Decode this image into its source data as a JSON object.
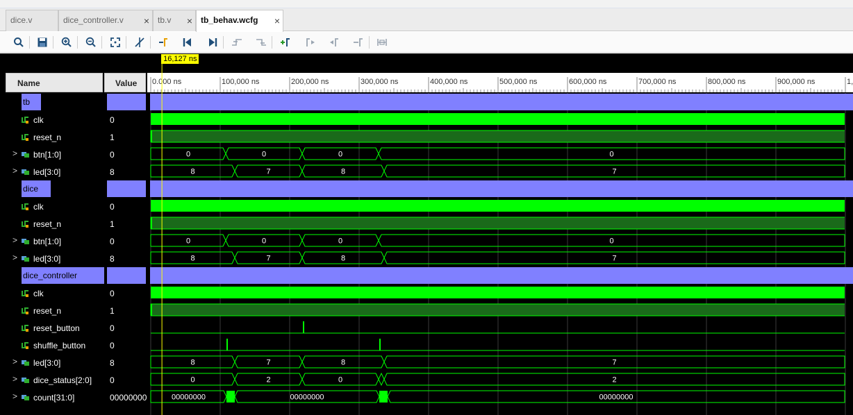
{
  "tabs": [
    {
      "label": "dice.v",
      "close": "×",
      "active": false
    },
    {
      "label": "dice_controller.v",
      "close": "×",
      "active": false
    },
    {
      "label": "tb.v",
      "close": "×",
      "active": false
    },
    {
      "label": "tb_behav.wcfg",
      "close": "×",
      "active": true
    }
  ],
  "toolbar": {
    "icons": [
      "search-icon",
      "save-icon",
      "zoom-in-icon",
      "zoom-out-icon",
      "zoom-fit-icon",
      "cursor-off-icon",
      "goto-cursor-icon",
      "goto-start-icon",
      "goto-end-icon",
      "prev-transition-icon",
      "next-transition-icon",
      "add-marker-icon",
      "prev-marker-icon",
      "next-marker-icon",
      "swap-cursors-icon",
      "fit-markers-icon"
    ]
  },
  "columns": {
    "name": "Name",
    "value": "Value"
  },
  "cursor": {
    "label": "16,127 ns",
    "time_ns": 16127
  },
  "timeline": {
    "ticks": [
      "0.000 ns",
      "100,000 ns",
      "200,000 ns",
      "300,000 ns",
      "400,000 ns",
      "500,000 ns",
      "600,000 ns",
      "700,000 ns",
      "800,000 ns",
      "900,000 ns",
      "1,"
    ],
    "tick_values_ns": [
      0,
      100000,
      200000,
      300000,
      400000,
      500000,
      600000,
      700000,
      800000,
      900000,
      1000000
    ]
  },
  "colors": {
    "scope": "#8080ff",
    "wave": "#00ff00",
    "wave_dark": "#1a6a1a",
    "cursor": "#ffff00",
    "background": "#000000"
  },
  "rows": [
    {
      "kind": "scope",
      "name": "tb",
      "value": ""
    },
    {
      "kind": "clock",
      "name": "clk",
      "value": "0",
      "icon": "wire-icon"
    },
    {
      "kind": "reset",
      "name": "reset_n",
      "value": "1",
      "icon": "wire-icon"
    },
    {
      "kind": "bus",
      "name": "btn[1:0]",
      "value": "0",
      "icon": "bus-icon",
      "expand": ">",
      "segments": [
        {
          "start": 0,
          "end": 108000,
          "label": "0"
        },
        {
          "start": 108000,
          "end": 218000,
          "label": "0"
        },
        {
          "start": 218000,
          "end": 328000,
          "label": "0"
        },
        {
          "start": 328000,
          "end": 1000000,
          "label": "0"
        }
      ]
    },
    {
      "kind": "bus",
      "name": "led[3:0]",
      "value": "8",
      "icon": "bus-icon",
      "expand": ">",
      "segments": [
        {
          "start": 0,
          "end": 121000,
          "label": "8"
        },
        {
          "start": 121000,
          "end": 218000,
          "label": "7"
        },
        {
          "start": 218000,
          "end": 336000,
          "label": "8"
        },
        {
          "start": 336000,
          "end": 1000000,
          "label": "7"
        }
      ]
    },
    {
      "kind": "scope",
      "name": "dice",
      "value": ""
    },
    {
      "kind": "clock",
      "name": "clk",
      "value": "0",
      "icon": "wire-icon"
    },
    {
      "kind": "reset",
      "name": "reset_n",
      "value": "1",
      "icon": "wire-icon"
    },
    {
      "kind": "bus",
      "name": "btn[1:0]",
      "value": "0",
      "icon": "bus-icon",
      "expand": ">",
      "segments": [
        {
          "start": 0,
          "end": 108000,
          "label": "0"
        },
        {
          "start": 108000,
          "end": 218000,
          "label": "0"
        },
        {
          "start": 218000,
          "end": 328000,
          "label": "0"
        },
        {
          "start": 328000,
          "end": 1000000,
          "label": "0"
        }
      ]
    },
    {
      "kind": "bus",
      "name": "led[3:0]",
      "value": "8",
      "icon": "bus-icon",
      "expand": ">",
      "segments": [
        {
          "start": 0,
          "end": 121000,
          "label": "8"
        },
        {
          "start": 121000,
          "end": 218000,
          "label": "7"
        },
        {
          "start": 218000,
          "end": 336000,
          "label": "8"
        },
        {
          "start": 336000,
          "end": 1000000,
          "label": "7"
        }
      ]
    },
    {
      "kind": "scope",
      "name": "dice_controller",
      "value": ""
    },
    {
      "kind": "clock",
      "name": "clk",
      "value": "0",
      "icon": "wire-icon"
    },
    {
      "kind": "reset",
      "name": "reset_n",
      "value": "1",
      "icon": "wire-icon"
    },
    {
      "kind": "pulse",
      "name": "reset_button",
      "value": "0",
      "icon": "wire-icon",
      "pulses_ns": [
        219000
      ]
    },
    {
      "kind": "pulse",
      "name": "shuffle_button",
      "value": "0",
      "icon": "wire-icon",
      "pulses_ns": [
        109000,
        329000
      ]
    },
    {
      "kind": "bus",
      "name": "led[3:0]",
      "value": "8",
      "icon": "bus-icon",
      "expand": ">",
      "segments": [
        {
          "start": 0,
          "end": 121000,
          "label": "8"
        },
        {
          "start": 121000,
          "end": 218000,
          "label": "7"
        },
        {
          "start": 218000,
          "end": 336000,
          "label": "8"
        },
        {
          "start": 336000,
          "end": 1000000,
          "label": "7"
        }
      ]
    },
    {
      "kind": "bus",
      "name": "dice_status[2:0]",
      "value": "0",
      "icon": "bus-icon",
      "expand": ">",
      "segments": [
        {
          "start": 0,
          "end": 121000,
          "label": "0"
        },
        {
          "start": 121000,
          "end": 218000,
          "label": "2"
        },
        {
          "start": 218000,
          "end": 328000,
          "label": "0"
        },
        {
          "start": 328000,
          "end": 336000,
          "label": ""
        },
        {
          "start": 336000,
          "end": 1000000,
          "label": "2"
        }
      ]
    },
    {
      "kind": "bus",
      "name": "count[31:0]",
      "value": "00000000",
      "icon": "bus-icon",
      "expand": ">",
      "segments": [
        {
          "start": 0,
          "end": 109000,
          "label": "00000000"
        },
        {
          "start": 109000,
          "end": 121000,
          "label": "",
          "dense": true
        },
        {
          "start": 121000,
          "end": 329000,
          "label": "00000000"
        },
        {
          "start": 329000,
          "end": 341000,
          "label": "",
          "dense": true
        },
        {
          "start": 341000,
          "end": 1000000,
          "label": "00000000"
        }
      ]
    }
  ]
}
